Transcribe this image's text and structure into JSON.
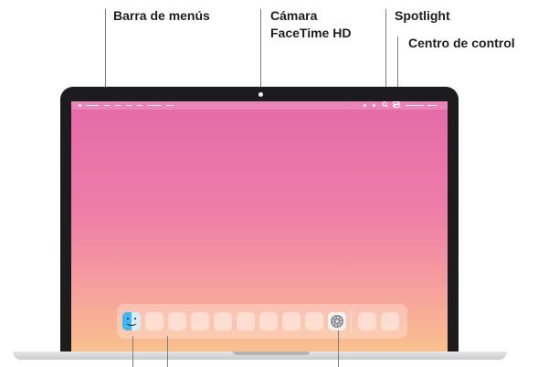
{
  "callouts": {
    "menu_bar": "Barra de menús",
    "camera_line1": "Cámara",
    "camera_line2": "FaceTime HD",
    "spotlight": "Spotlight",
    "control_center": "Centro de control"
  },
  "icons": {
    "finder": "finder-icon",
    "settings": "system-settings-icon",
    "spotlight": "search-icon",
    "control_center": "control-center-icon"
  },
  "colors": {
    "bezel": "#1c1c1e",
    "wallpaper_top": "#e46aa9",
    "wallpaper_bottom": "#f9c08c",
    "leader_line": "#7d7d7d"
  }
}
